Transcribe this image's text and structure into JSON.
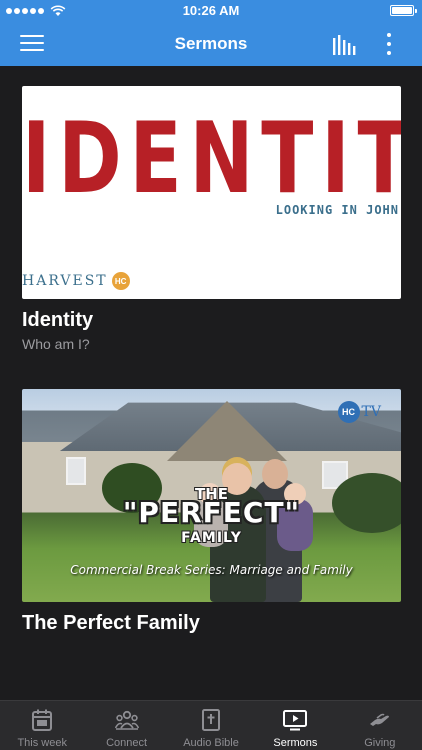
{
  "status_bar": {
    "time": "10:26 AM",
    "signal_icon": "signal-dots-icon",
    "wifi_icon": "wifi-icon",
    "battery_icon": "battery-full-icon"
  },
  "nav": {
    "title": "Sermons",
    "menu_icon": "hamburger-menu-icon",
    "audio_icon": "audio-bars-icon",
    "more_icon": "more-vertical-icon",
    "bar_color": "#3a8de0"
  },
  "sermons": [
    {
      "title": "Identity",
      "subtitle": "Who am I?",
      "artwork": {
        "headline": "IDENTITY",
        "tagline": "LOOKING IN JOHN",
        "brand": "HARVEST",
        "brand_badge": "HC"
      }
    },
    {
      "title": "The Perfect Family",
      "subtitle": "",
      "artwork": {
        "kicker": "THE",
        "headline": "\"PERFECT\"",
        "subline": "FAMILY",
        "caption": "Commercial Break Series: Marriage and Family",
        "logo_badge": "HC",
        "logo_text": "TV"
      }
    }
  ],
  "tabs": [
    {
      "label": "This week",
      "icon": "calendar-icon",
      "active": false
    },
    {
      "label": "Connect",
      "icon": "people-group-icon",
      "active": false
    },
    {
      "label": "Audio Bible",
      "icon": "bible-icon",
      "active": false
    },
    {
      "label": "Sermons",
      "icon": "video-play-icon",
      "active": true
    },
    {
      "label": "Giving",
      "icon": "giving-hand-icon",
      "active": false
    }
  ],
  "colors": {
    "background": "#1c1c1e",
    "accent": "#3a8de0",
    "identity_red": "#b72026",
    "tab_active": "#ffffff",
    "tab_inactive": "#8e8e93"
  }
}
